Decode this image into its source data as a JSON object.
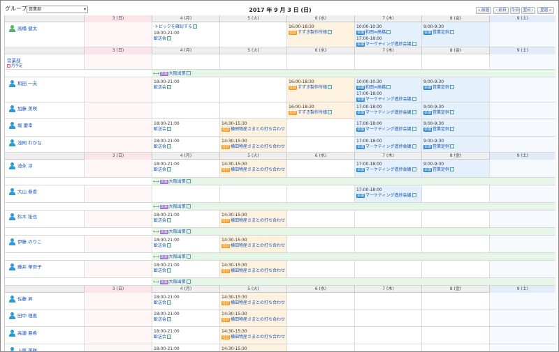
{
  "toolbar": {
    "group_label": "グループ",
    "group_value": "営業部",
    "date_title": "2017 年 9 月 3 日 (日)",
    "buttons": {
      "prev_week": "« 前週",
      "prev_day": "‹ 前日",
      "today": "今日",
      "next_day": "翌日 ›",
      "next_week": "翌週 »"
    }
  },
  "days": [
    "3 (日)",
    "4 (月)",
    "5 (火)",
    "6 (水)",
    "7 (木)",
    "8 (金)",
    "9 (土)"
  ],
  "dept": {
    "name": "営業部",
    "plan_label": "月予定"
  },
  "common": {
    "topic": "トピックを確認する",
    "late_time": "18:00-21:00",
    "late_name": "歓送会",
    "osaka_tag": "出張",
    "osaka_name": "大阪出張",
    "suzuki_time": "16:00-18:30",
    "suzuki_tag": "往訪",
    "suzuki_name": "すずき製作所様",
    "yokota_time": "14:30-15:30",
    "yokota_tag": "往訪",
    "yokota_name": "横田物産さまとの打ち合わせ",
    "wada_time": "10:00-10:30",
    "wada_tag": "会議",
    "wada_name": "和田⇔高橋",
    "marketing_time": "17:00-18:00",
    "marketing_tag": "会議",
    "marketing_name": "マーケティング進捗会議",
    "teirei_time": "9:00-9:30",
    "teirei_tag": "会議",
    "teirei_name": "営業定例"
  },
  "users": [
    "高橋 健太",
    "和田 一夫",
    "加藤 美咲",
    "堀   慶幸",
    "浅岡 わかな",
    "池永 淳",
    "大山 春香",
    "鈴木 拓也",
    "伊藤 のりこ",
    "藤井 華奈子",
    "佐藤 昇",
    "田中 理恵",
    "高瀬 亜希",
    "上原 美咲"
  ]
}
